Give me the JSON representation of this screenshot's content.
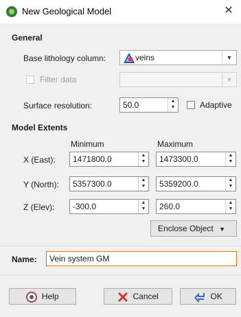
{
  "window": {
    "title": "New Geological Model"
  },
  "general": {
    "heading": "General",
    "base_lithology_label": "Base lithology column:",
    "base_lithology_value": "veins",
    "filter_data_label": "Filter data",
    "surface_resolution_label": "Surface resolution:",
    "surface_resolution_value": "50.0",
    "adaptive_label": "Adaptive"
  },
  "extents": {
    "heading": "Model Extents",
    "minimum_header": "Minimum",
    "maximum_header": "Maximum",
    "rows": [
      {
        "label": "X (East):",
        "min": "1471800.0",
        "max": "1473300.0"
      },
      {
        "label": "Y (North):",
        "min": "5357300.0",
        "max": "5359200.0"
      },
      {
        "label": "Z (Elev):",
        "min": "-300.0",
        "max": "260.0"
      }
    ],
    "enclose_button": "Enclose Object"
  },
  "name": {
    "label": "Name:",
    "value": "Vein system GM"
  },
  "buttons": {
    "help": "Help",
    "cancel": "Cancel",
    "ok": "OK"
  },
  "colors": {
    "accent": "#d97a00",
    "title_bg": "#ffffff",
    "dialog_bg": "#f0f0f0"
  }
}
